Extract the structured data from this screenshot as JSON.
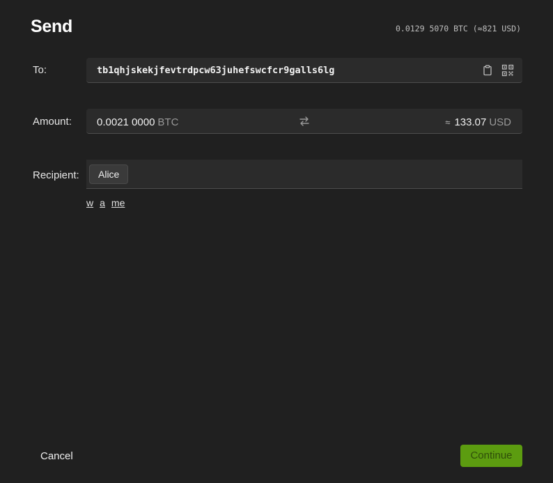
{
  "header": {
    "title": "Send",
    "balance": "0.0129 5070 BTC (≈821 USD)"
  },
  "to": {
    "label": "To:",
    "address": "tb1qhjskekjfevtrdpcw63juhefswcfcr9galls6lg",
    "paste_icon": "clipboard-icon",
    "scan_icon": "qr-code-icon"
  },
  "amount": {
    "label": "Amount:",
    "value": "0.0021 0000",
    "unit": "BTC",
    "swap_icon": "swap-arrows-icon",
    "approx": "≈",
    "fiat_value": "133.07",
    "fiat_unit": "USD"
  },
  "recipient": {
    "label": "Recipient:",
    "chip": "Alice",
    "suggestions": [
      "w",
      "a",
      "me"
    ]
  },
  "footer": {
    "cancel_label": "Cancel",
    "continue_label": "Continue"
  },
  "colors": {
    "background": "#202020",
    "field": "#2b2b2b",
    "accent": "#5c9c10"
  }
}
